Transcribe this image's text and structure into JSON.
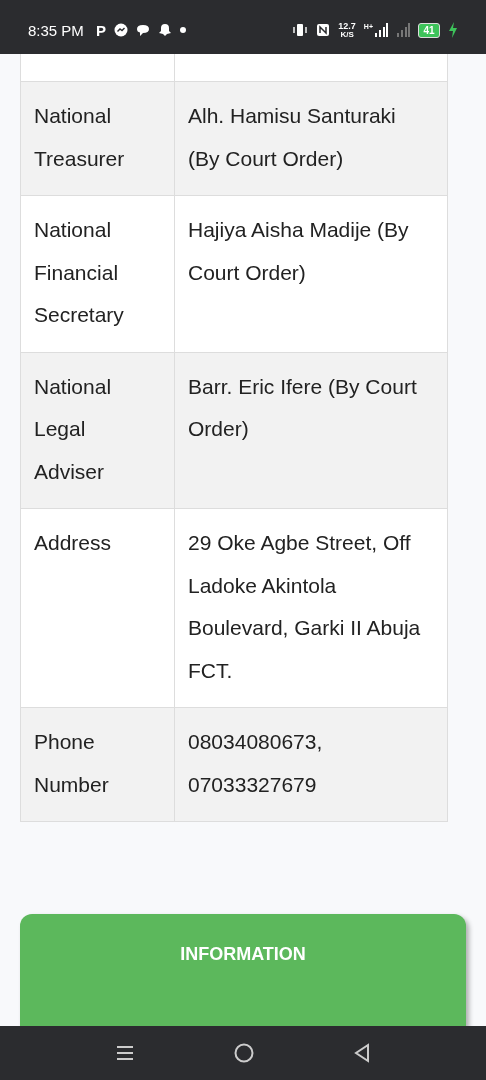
{
  "status_bar": {
    "time": "8:35 PM",
    "app_letter": "P",
    "speed": "12.7",
    "speed_unit": "K/S",
    "network": "H+",
    "battery": "41",
    "charging": true
  },
  "table": {
    "rows": [
      {
        "label": "National Treasurer",
        "value": "Alh. Hamisu Santuraki (By Court Order)"
      },
      {
        "label": "National Financial Secretary",
        "value": "Hajiya Aisha Madije (By Court Order)"
      },
      {
        "label": "National Legal Adviser",
        "value": "Barr. Eric Ifere (By Court Order)"
      },
      {
        "label": "Address",
        "value": "29 Oke Agbe Street, Off Ladoke Akintola Boulevard, Garki II Abuja FCT."
      },
      {
        "label": "Phone Number",
        "value": "08034080673, 07033327679"
      }
    ]
  },
  "info_card": {
    "title": "INFORMATION"
  }
}
